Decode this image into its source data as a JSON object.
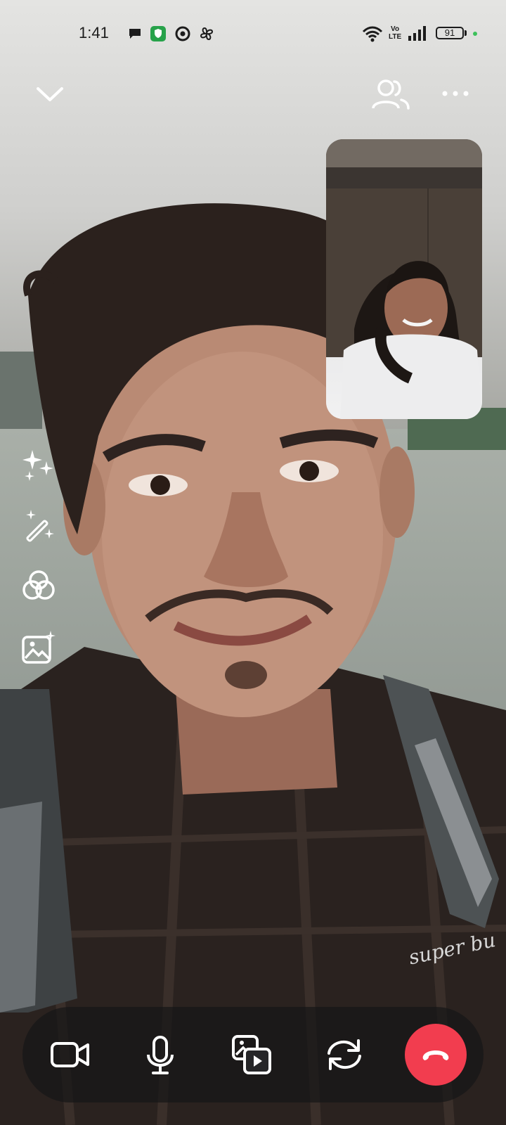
{
  "status_bar": {
    "time": "1:41",
    "network_label_top": "Vo",
    "network_label_bottom": "LTE",
    "battery_level": "91",
    "icons": [
      "chat-bubble-icon",
      "shield-app-icon",
      "chrome-icon",
      "pinwheel-icon",
      "wifi-icon",
      "signal-icon",
      "battery-icon"
    ]
  },
  "top_controls": {
    "icons": [
      "chevron-down-icon",
      "participants-icon",
      "more-options-icon"
    ]
  },
  "side_effects": {
    "icons": [
      "sparkles-icon",
      "magic-wand-icon",
      "filter-circles-icon",
      "background-image-icon"
    ]
  },
  "call_controls": {
    "icons": [
      "camera-toggle-icon",
      "microphone-icon",
      "share-media-icon",
      "flip-camera-icon",
      "end-call-icon"
    ],
    "end_call_color": "#f23d4f"
  },
  "colors": {
    "bar_background": "rgba(22,22,24,0.72)",
    "icon_color": "#ffffff"
  }
}
